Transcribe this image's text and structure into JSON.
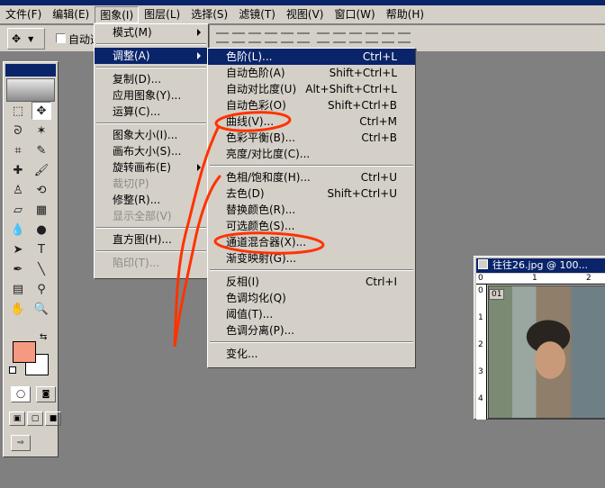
{
  "menubar": {
    "items": [
      "文件(F)",
      "编辑(E)",
      "图象(I)",
      "图层(L)",
      "选择(S)",
      "滤镜(T)",
      "视图(V)",
      "窗口(W)",
      "帮助(H)"
    ]
  },
  "options": {
    "checkbox_label": "自动选"
  },
  "image_menu": {
    "items": [
      {
        "label": "模式(M)",
        "submenu": true
      },
      {
        "sep": true
      },
      {
        "label": "调整(A)",
        "submenu": true,
        "highlight": true
      },
      {
        "sep": true
      },
      {
        "label": "复制(D)..."
      },
      {
        "label": "应用图象(Y)..."
      },
      {
        "label": "运算(C)..."
      },
      {
        "sep": true
      },
      {
        "label": "图象大小(I)..."
      },
      {
        "label": "画布大小(S)..."
      },
      {
        "label": "旋转画布(E)",
        "submenu": true
      },
      {
        "label": "裁切(P)",
        "disabled": true
      },
      {
        "label": "修整(R)..."
      },
      {
        "label": "显示全部(V)",
        "disabled": true
      },
      {
        "sep": true
      },
      {
        "label": "直方图(H)..."
      },
      {
        "sep": true
      },
      {
        "label": "陷印(T)...",
        "disabled": true
      }
    ]
  },
  "adjust_menu": {
    "items": [
      {
        "label": "色阶(L)...",
        "shortcut": "Ctrl+L",
        "highlight": true
      },
      {
        "label": "自动色阶(A)",
        "shortcut": "Shift+Ctrl+L"
      },
      {
        "label": "自动对比度(U)",
        "shortcut": "Alt+Shift+Ctrl+L"
      },
      {
        "label": "自动色彩(O)",
        "shortcut": "Shift+Ctrl+B"
      },
      {
        "label": "曲线(V)...",
        "shortcut": "Ctrl+M"
      },
      {
        "label": "色彩平衡(B)...",
        "shortcut": "Ctrl+B"
      },
      {
        "label": "亮度/对比度(C)..."
      },
      {
        "sep": true
      },
      {
        "label": "色相/饱和度(H)...",
        "shortcut": "Ctrl+U"
      },
      {
        "label": "去色(D)",
        "shortcut": "Shift+Ctrl+U"
      },
      {
        "label": "替换颜色(R)..."
      },
      {
        "label": "可选颜色(S)..."
      },
      {
        "label": "通道混合器(X)..."
      },
      {
        "label": "渐变映射(G)..."
      },
      {
        "sep": true
      },
      {
        "label": "反相(I)",
        "shortcut": "Ctrl+I"
      },
      {
        "label": "色调均化(Q)"
      },
      {
        "label": "阈值(T)..."
      },
      {
        "label": "色调分离(P)..."
      },
      {
        "sep": true
      },
      {
        "label": "变化..."
      }
    ]
  },
  "image_window": {
    "title": "往往26.jpg @ 100...",
    "ruler_h": [
      "0",
      "1",
      "2"
    ],
    "ruler_v": [
      "0",
      "1",
      "2",
      "3",
      "4"
    ],
    "layer_tag": "01"
  },
  "colors": {
    "foreground": "#f59a80",
    "background": "#ffffff",
    "highlight": "#0a246a",
    "annotation": "#ff3300"
  }
}
